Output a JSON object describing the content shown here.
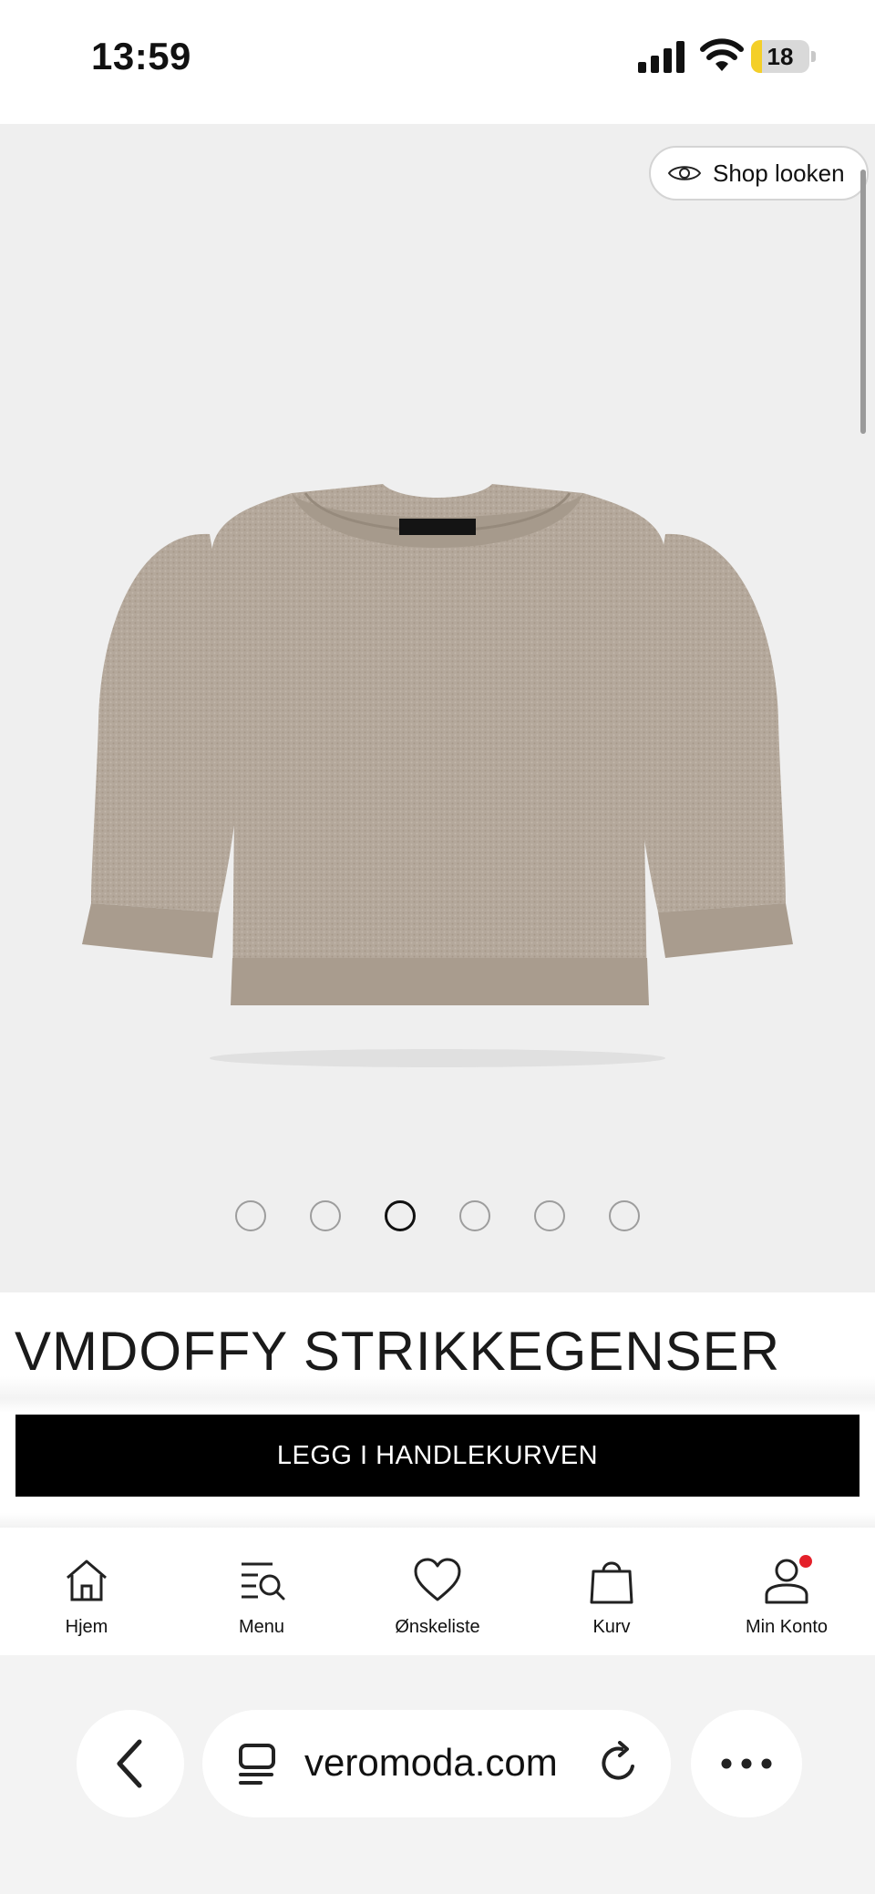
{
  "status_bar": {
    "time": "13:59",
    "battery_level": "18",
    "battery_fraction": 0.18,
    "battery_color": "#f4cf28"
  },
  "product": {
    "shop_look_label": "Shop looken",
    "shop_look_icon": "eye-icon",
    "image_subject": "sweater-image",
    "image_count": 6,
    "active_image_index": 2,
    "title": "VMDOFFY STRIKKEGENSER",
    "add_to_cart_label": "LEGG I HANDLEKURVEN"
  },
  "bottom_nav": {
    "items": [
      {
        "label": "Hjem",
        "icon": "home-icon"
      },
      {
        "label": "Menu",
        "icon": "menu-search-icon"
      },
      {
        "label": "Ønskeliste",
        "icon": "heart-icon"
      },
      {
        "label": "Kurv",
        "icon": "shopping-bag-icon"
      },
      {
        "label": "Min Konto",
        "icon": "user-icon",
        "has_notification": true
      }
    ]
  },
  "browser": {
    "url": "veromoda.com",
    "back_icon": "chevron-left-icon",
    "tabs_icon": "tabs-icon",
    "reload_icon": "reload-icon",
    "more_icon": "more-icon"
  },
  "colors": {
    "image_background": "#efefef",
    "primary_button": "#000000",
    "notification": "#e4202a",
    "sweater": "#b4a89b"
  }
}
